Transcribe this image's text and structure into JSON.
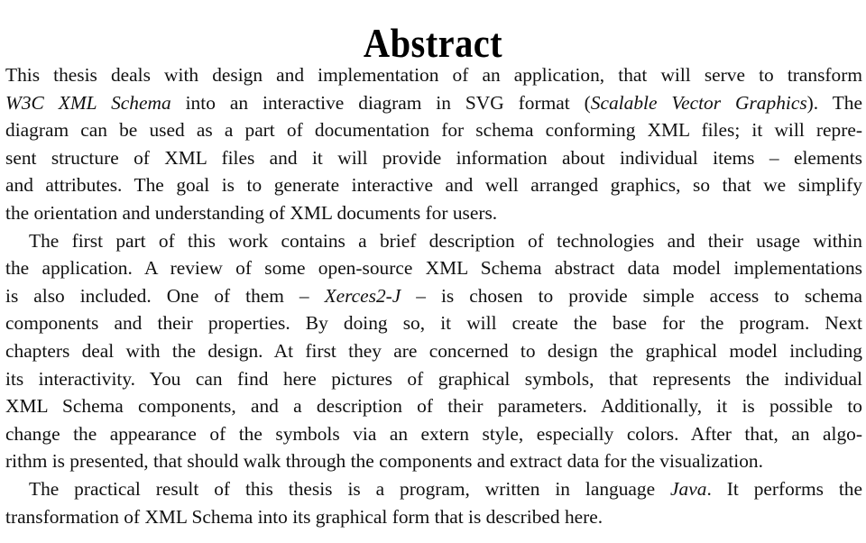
{
  "document": {
    "title": "Abstract",
    "paragraphs": [
      {
        "lines": [
          {
            "segments": [
              {
                "text": "This thesis deals with design and implementation of an application, that will serve to transform",
                "italic": false
              }
            ]
          },
          {
            "segments": [
              {
                "text": "W3C XML Schema",
                "italic": true
              },
              {
                "text": " into an interactive diagram in SVG format (",
                "italic": false
              },
              {
                "text": "Scalable Vector Graphics",
                "italic": true
              },
              {
                "text": "). The",
                "italic": false
              }
            ]
          },
          {
            "segments": [
              {
                "text": "diagram can be used as a part of documentation for schema conforming XML files; it will repre-",
                "italic": false
              }
            ]
          },
          {
            "segments": [
              {
                "text": "sent structure of XML files and it will provide information about individual items – elements",
                "italic": false
              }
            ]
          },
          {
            "segments": [
              {
                "text": "and attributes. The goal is to generate interactive and well arranged graphics, so that we simplify",
                "italic": false
              }
            ]
          },
          {
            "segments": [
              {
                "text": "the orientation and understanding of XML documents for users.",
                "italic": false
              }
            ]
          }
        ]
      },
      {
        "lines": [
          {
            "segments": [
              {
                "text": "The first part of this work contains a brief description of technologies and their usage within",
                "italic": false
              }
            ]
          },
          {
            "segments": [
              {
                "text": "the application. A review of some open-source XML Schema abstract data model implementations",
                "italic": false
              }
            ]
          },
          {
            "segments": [
              {
                "text": "is also included. One of them – ",
                "italic": false
              },
              {
                "text": "Xerces2-J",
                "italic": true
              },
              {
                "text": " – is chosen to provide simple access to schema",
                "italic": false
              }
            ]
          },
          {
            "segments": [
              {
                "text": "components and their properties. By doing so, it will create the base for the program. Next",
                "italic": false
              }
            ]
          },
          {
            "segments": [
              {
                "text": "chapters deal with the design. At first they are concerned to design the graphical model including",
                "italic": false
              }
            ]
          },
          {
            "segments": [
              {
                "text": "its interactivity. You can find here pictures of graphical symbols, that represents the individual",
                "italic": false
              }
            ]
          },
          {
            "segments": [
              {
                "text": "XML Schema components, and a description of their parameters. Additionally, it is possible to",
                "italic": false
              }
            ]
          },
          {
            "segments": [
              {
                "text": "change the appearance of the symbols via an extern style, especially colors. After that, an algo-",
                "italic": false
              }
            ]
          },
          {
            "segments": [
              {
                "text": "rithm is presented, that should walk through the components and extract data for the visualization.",
                "italic": false
              }
            ]
          }
        ]
      },
      {
        "lines": [
          {
            "segments": [
              {
                "text": "The practical result of this thesis is a program, written in language ",
                "italic": false
              },
              {
                "text": "Java",
                "italic": true
              },
              {
                "text": ". It performs the",
                "italic": false
              }
            ]
          },
          {
            "segments": [
              {
                "text": "transformation of XML Schema into its graphical form that is described here.",
                "italic": false
              }
            ]
          }
        ]
      }
    ]
  }
}
